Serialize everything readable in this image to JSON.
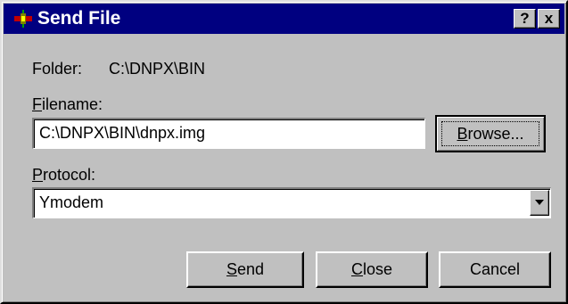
{
  "window": {
    "title": "Send File",
    "help_button": "?",
    "close_button": "x"
  },
  "folder": {
    "label": "Folder:",
    "value": "C:\\DNPX\\BIN"
  },
  "filename": {
    "label_mnemonic": "F",
    "label_rest": "ilename:",
    "value": "C:\\DNPX\\BIN\\dnpx.img"
  },
  "browse_button": {
    "mnemonic": "B",
    "rest": "rowse..."
  },
  "protocol": {
    "label_mnemonic": "P",
    "label_rest": "rotocol:",
    "selected": "Ymodem"
  },
  "buttons": {
    "send_mnemonic": "S",
    "send_rest": "end",
    "close_mnemonic": "C",
    "close_rest": "lose",
    "cancel": "Cancel"
  },
  "colors": {
    "titlebar": "#000080",
    "face": "#c0c0c0"
  },
  "icons": {
    "app": "satellite-app-icon",
    "dropdown": "chevron-down-icon"
  }
}
